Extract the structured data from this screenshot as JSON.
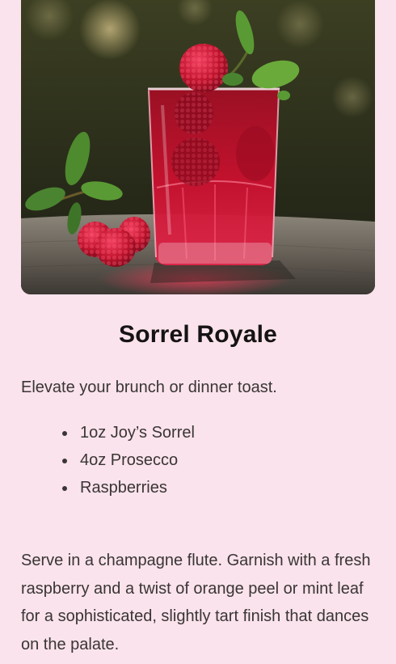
{
  "recipe": {
    "image": {
      "subject": "raspberry-cocktail-photo"
    },
    "title": "Sorrel Royale",
    "intro": "Elevate your brunch or dinner toast.",
    "ingredients": [
      "1oz Joy’s Sorrel",
      "4oz Prosecco",
      "Raspberries"
    ],
    "serving_note": "Serve in a champagne flute. Garnish with a fresh raspberry and a twist of orange peel or mint leaf for a sophisticated, slightly tart finish that dances on the palate."
  },
  "colors": {
    "page_background": "#fae3ec",
    "title_text": "#161314",
    "body_text": "#3a3535",
    "drink_red": "#c8102e"
  }
}
